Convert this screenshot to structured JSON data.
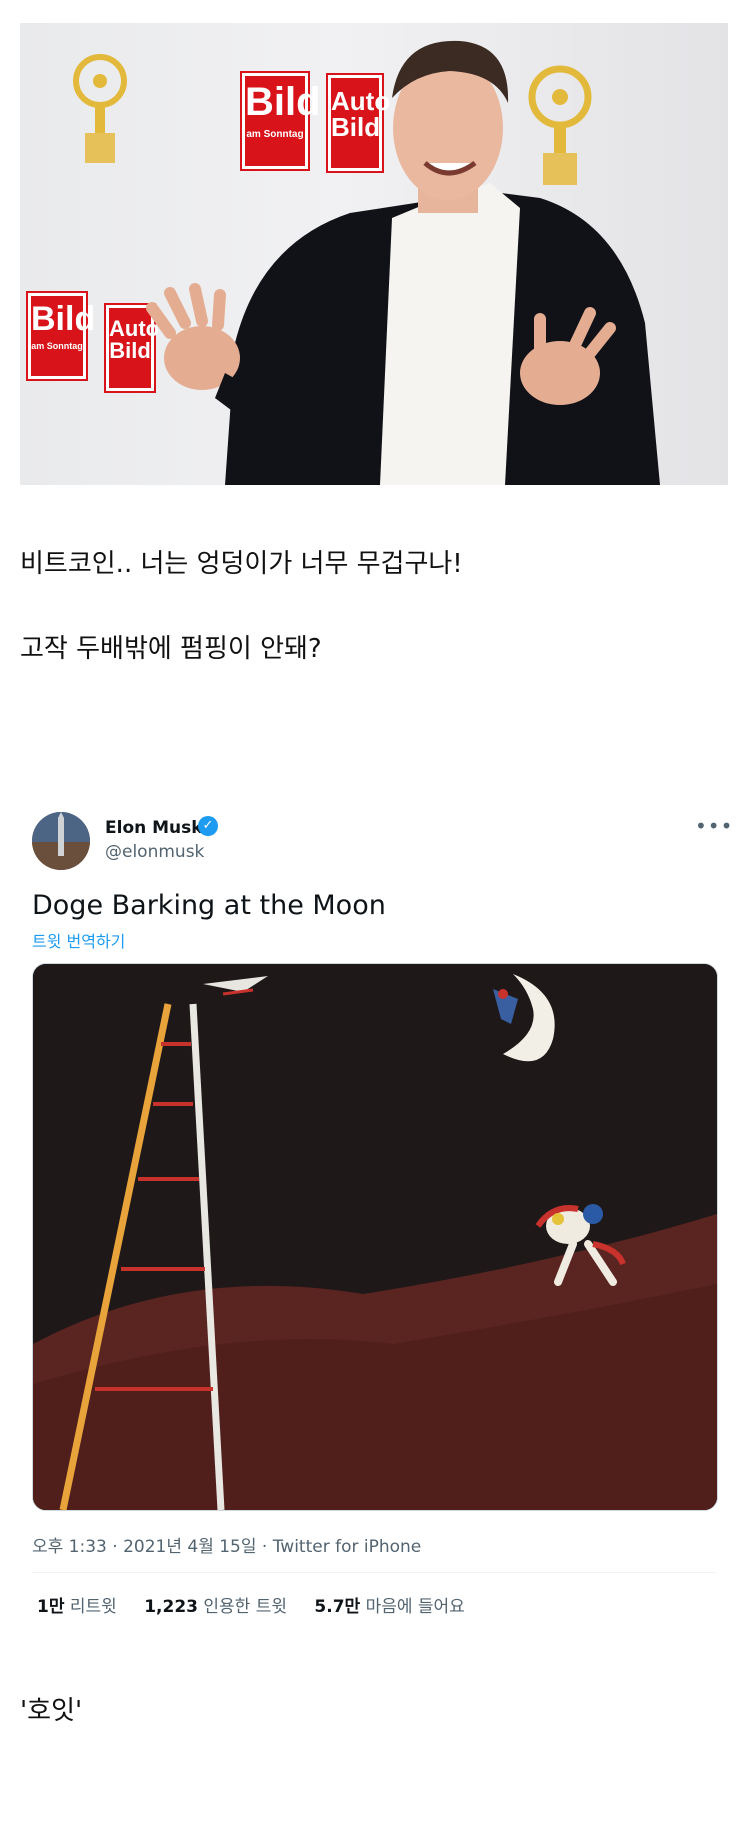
{
  "photo": {
    "logo_text_main": "Bild",
    "logo_text_sub": "am Sonntag",
    "logo_text_auto": "Auto Bild"
  },
  "captions": {
    "line1": "비트코인.. 너는 엉덩이가 너무 무겁구나!",
    "line2": "고작 두배밖에 펌핑이 안돼?",
    "line3": "'호잇'"
  },
  "tweet": {
    "author_name": "Elon Musk",
    "handle": "@elonmusk",
    "verified_icon": "✓",
    "more_icon": "•••",
    "text": "Doge Barking at the Moon",
    "translate_label": "트윗 번역하기",
    "meta": "오후 1:33 · 2021년 4월 15일 · Twitter for iPhone",
    "retweets_value": "1만",
    "retweets_label": "리트윗",
    "quotes_value": "1,223",
    "quotes_label": "인용한 트윗",
    "likes_value": "5.7만",
    "likes_label": "마음에 들어요"
  },
  "colors": {
    "link": "#1d9bf0",
    "secondary_text": "#536471",
    "bild_red": "#d8141a"
  }
}
